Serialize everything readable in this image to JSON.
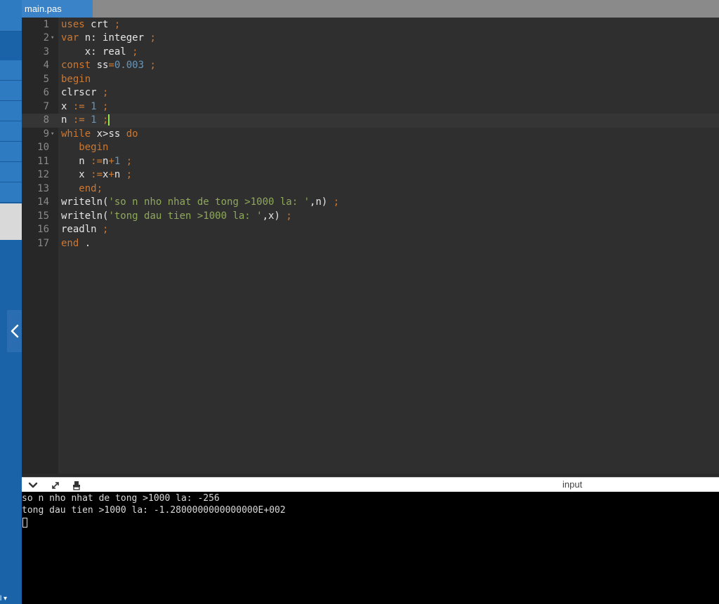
{
  "tab": {
    "title": "main.pas"
  },
  "sidebar": {
    "toggle_glyph": "‹",
    "bottom_label": "l ▾"
  },
  "editor": {
    "active_line": 8,
    "lines": [
      {
        "n": "1",
        "fold": "",
        "tokens": [
          [
            "kw",
            "uses"
          ],
          [
            "id",
            " crt "
          ],
          [
            "op",
            ";"
          ]
        ]
      },
      {
        "n": "2",
        "fold": "▾",
        "tokens": [
          [
            "kw",
            "var"
          ],
          [
            "id",
            " n: integer "
          ],
          [
            "op",
            ";"
          ]
        ]
      },
      {
        "n": "3",
        "fold": "",
        "tokens": [
          [
            "id",
            "    x: real "
          ],
          [
            "op",
            ";"
          ]
        ]
      },
      {
        "n": "4",
        "fold": "",
        "tokens": [
          [
            "kw",
            "const"
          ],
          [
            "id",
            " ss"
          ],
          [
            "op",
            "="
          ],
          [
            "num",
            "0.003"
          ],
          [
            "id",
            " "
          ],
          [
            "op",
            ";"
          ]
        ]
      },
      {
        "n": "5",
        "fold": "",
        "tokens": [
          [
            "kw",
            "begin"
          ]
        ]
      },
      {
        "n": "6",
        "fold": "",
        "tokens": [
          [
            "id",
            "clrscr "
          ],
          [
            "op",
            ";"
          ]
        ]
      },
      {
        "n": "7",
        "fold": "",
        "tokens": [
          [
            "id",
            "x "
          ],
          [
            "op",
            ":="
          ],
          [
            "id",
            " "
          ],
          [
            "num",
            "1"
          ],
          [
            "id",
            " "
          ],
          [
            "op",
            ";"
          ]
        ]
      },
      {
        "n": "8",
        "fold": "",
        "tokens": [
          [
            "id",
            "n "
          ],
          [
            "op",
            ":="
          ],
          [
            "id",
            " "
          ],
          [
            "num",
            "1"
          ],
          [
            "id",
            " "
          ],
          [
            "op",
            ";"
          ]
        ],
        "caret": true
      },
      {
        "n": "9",
        "fold": "▾",
        "tokens": [
          [
            "kw",
            "while"
          ],
          [
            "id",
            " x>ss "
          ],
          [
            "kw",
            "do"
          ]
        ]
      },
      {
        "n": "10",
        "fold": "",
        "tokens": [
          [
            "id",
            "   "
          ],
          [
            "kw",
            "begin"
          ]
        ]
      },
      {
        "n": "11",
        "fold": "",
        "tokens": [
          [
            "id",
            "   n "
          ],
          [
            "op",
            ":="
          ],
          [
            "id",
            "n"
          ],
          [
            "op",
            "+"
          ],
          [
            "num",
            "1"
          ],
          [
            "id",
            " "
          ],
          [
            "op",
            ";"
          ]
        ]
      },
      {
        "n": "12",
        "fold": "",
        "tokens": [
          [
            "id",
            "   x "
          ],
          [
            "op",
            ":="
          ],
          [
            "id",
            "x"
          ],
          [
            "op",
            "+"
          ],
          [
            "id",
            "n "
          ],
          [
            "op",
            ";"
          ]
        ]
      },
      {
        "n": "13",
        "fold": "",
        "tokens": [
          [
            "id",
            "   "
          ],
          [
            "kw",
            "end"
          ],
          [
            "op",
            ";"
          ]
        ]
      },
      {
        "n": "14",
        "fold": "",
        "tokens": [
          [
            "id",
            "writeln("
          ],
          [
            "str",
            "'so n nho nhat de tong >1000 la: '"
          ],
          [
            "id",
            ",n) "
          ],
          [
            "op",
            ";"
          ]
        ]
      },
      {
        "n": "15",
        "fold": "",
        "tokens": [
          [
            "id",
            "writeln("
          ],
          [
            "str",
            "'tong dau tien >1000 la: '"
          ],
          [
            "id",
            ",x) "
          ],
          [
            "op",
            ";"
          ]
        ]
      },
      {
        "n": "16",
        "fold": "",
        "tokens": [
          [
            "id",
            "readln "
          ],
          [
            "op",
            ";"
          ]
        ]
      },
      {
        "n": "17",
        "fold": "",
        "tokens": [
          [
            "kw",
            "end"
          ],
          [
            "id",
            " ."
          ]
        ]
      }
    ]
  },
  "console_bar": {
    "collapse_icon": "chevron-down-icon",
    "expand_icon": "expand-icon",
    "clear_icon": "clear-console-icon",
    "input_label": "input"
  },
  "console": {
    "output": [
      "so n nho nhat de tong >1000 la: -256",
      "tong dau tien >1000 la: -1.2800000000000000E+002"
    ]
  },
  "colors": {
    "sidebar": "#1b63a8",
    "tab_active": "#3b83c9",
    "editor_bg": "#2f2f2f",
    "keyword": "#cc7832",
    "number": "#6897bb",
    "string": "#8fa95a",
    "caret": "#99e550"
  }
}
